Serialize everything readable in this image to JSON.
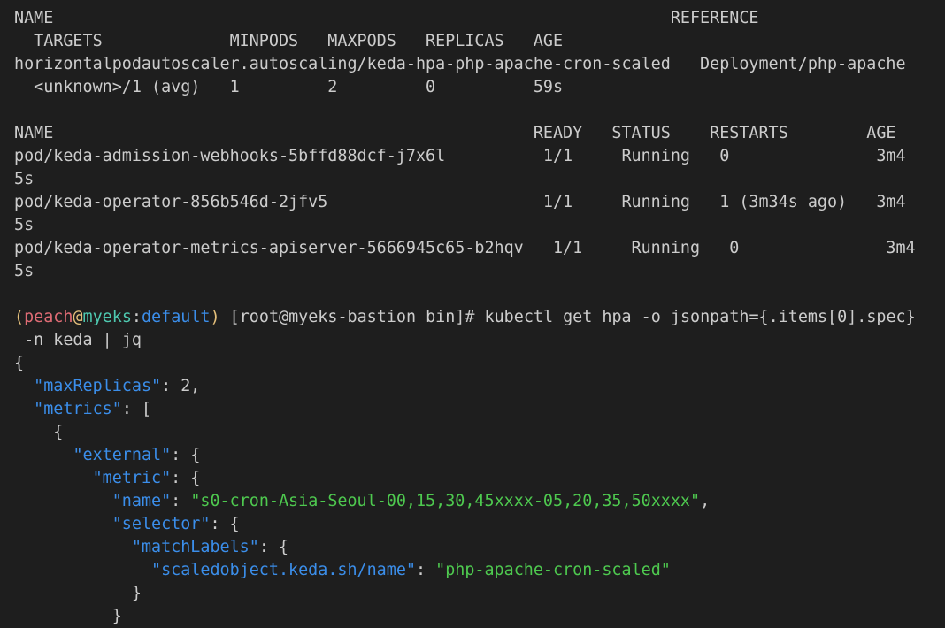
{
  "hpa_table": {
    "header1": "NAME                                                               REFERENCE",
    "header2": "  TARGETS             MINPODS   MAXPODS   REPLICAS   AGE",
    "row1": "horizontalpodautoscaler.autoscaling/keda-hpa-php-apache-cron-scaled   Deployment/php-apache",
    "row2": "  <unknown>/1 (avg)   1         2         0          59s"
  },
  "pods_table": {
    "header": "NAME                                                 READY   STATUS    RESTARTS        AGE",
    "rows": [
      {
        "line1": "pod/keda-admission-webhooks-5bffd88dcf-j7x6l          1/1     Running   0               3m4",
        "line2": "5s"
      },
      {
        "line1": "pod/keda-operator-856b546d-2jfv5                      1/1     Running   1 (3m34s ago)   3m4",
        "line2": "5s"
      },
      {
        "line1": "pod/keda-operator-metrics-apiserver-5666945c65-b2hqv   1/1     Running   0               3m4",
        "line2": "5s"
      }
    ]
  },
  "prompt": {
    "open_paren": "(",
    "user": "peach",
    "at": "@",
    "host": "myeks",
    "colon": ":",
    "namespace": "default",
    "close_paren": ")",
    "rest": " [root@myeks-bastion bin]# kubectl get hpa -o jsonpath={.items[0].spec}",
    "continuation": " -n keda | jq"
  },
  "json_output": {
    "open_brace": "{",
    "max_replicas_key": "\"maxReplicas\"",
    "max_replicas_val": ": 2,",
    "metrics_key": "\"metrics\"",
    "metrics_val": ": [",
    "item_open": "{",
    "external_key": "\"external\"",
    "external_val": ": {",
    "metric_key": "\"metric\"",
    "metric_val": ": {",
    "name_key": "\"name\"",
    "name_sep": ": ",
    "name_val": "\"s0-cron-Asia-Seoul-00,15,30,45xxxx-05,20,35,50xxxx\"",
    "name_end": ",",
    "selector_key": "\"selector\"",
    "selector_val": ": {",
    "matchlabels_key": "\"matchLabels\"",
    "matchlabels_val": ": {",
    "label_key": "\"scaledobject.keda.sh/name\"",
    "label_sep": ": ",
    "label_val": "\"php-apache-cron-scaled\"",
    "matchlabels_close": "}",
    "selector_close": "}"
  }
}
